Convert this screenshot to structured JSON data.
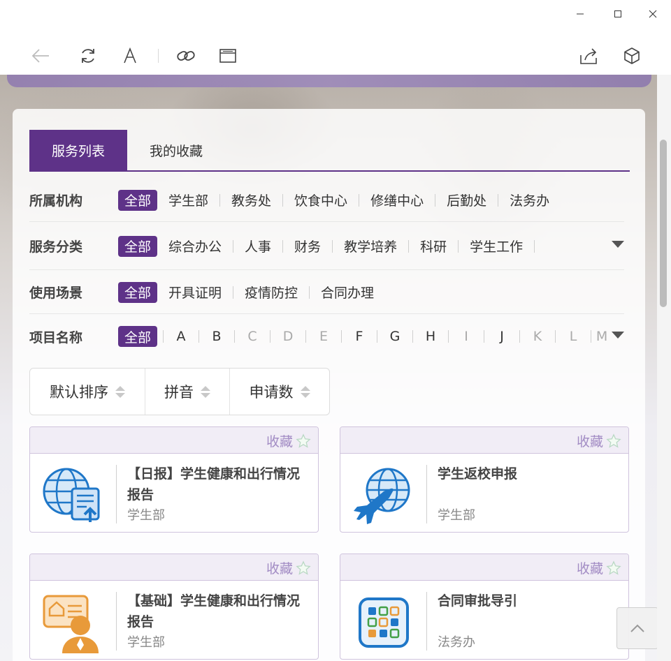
{
  "tabs": {
    "services": "服务列表",
    "favorites": "我的收藏"
  },
  "filters": [
    {
      "label": "所属机构",
      "items": [
        "全部",
        "学生部",
        "教务处",
        "饮食中心",
        "修缮中心",
        "后勤处",
        "法务办"
      ]
    },
    {
      "label": "服务分类",
      "items": [
        "全部",
        "综合办公",
        "人事",
        "财务",
        "教学培养",
        "科研",
        "学生工作"
      ]
    },
    {
      "label": "使用场景",
      "items": [
        "全部",
        "开具证明",
        "疫情防控",
        "合同办理"
      ]
    },
    {
      "label": "项目名称",
      "all": "全部",
      "letters": [
        "A",
        "B",
        "C",
        "D",
        "E",
        "F",
        "G",
        "H",
        "I",
        "J",
        "K",
        "L",
        "M"
      ],
      "muted_letters": [
        "C",
        "D",
        "E",
        "I",
        "K",
        "L",
        "M"
      ]
    }
  ],
  "sort": [
    "默认排序",
    "拼音",
    "申请数"
  ],
  "fav_label": "收藏",
  "cards": [
    {
      "title": "【日报】学生健康和出行情况报告",
      "dept": "学生部",
      "icon": "globe-document-upload-icon"
    },
    {
      "title": "学生返校申报",
      "dept": "学生部",
      "icon": "airplane-globe-icon"
    },
    {
      "title": "【基础】学生健康和出行情况报告",
      "dept": "学生部",
      "icon": "home-card-person-icon"
    },
    {
      "title": "合同审批导引",
      "dept": "法务办",
      "icon": "colored-grid-tablet-icon"
    }
  ],
  "colors": {
    "accent": "#5e3288",
    "fav": "#a28cc4",
    "card_border": "#cfc3dd"
  }
}
